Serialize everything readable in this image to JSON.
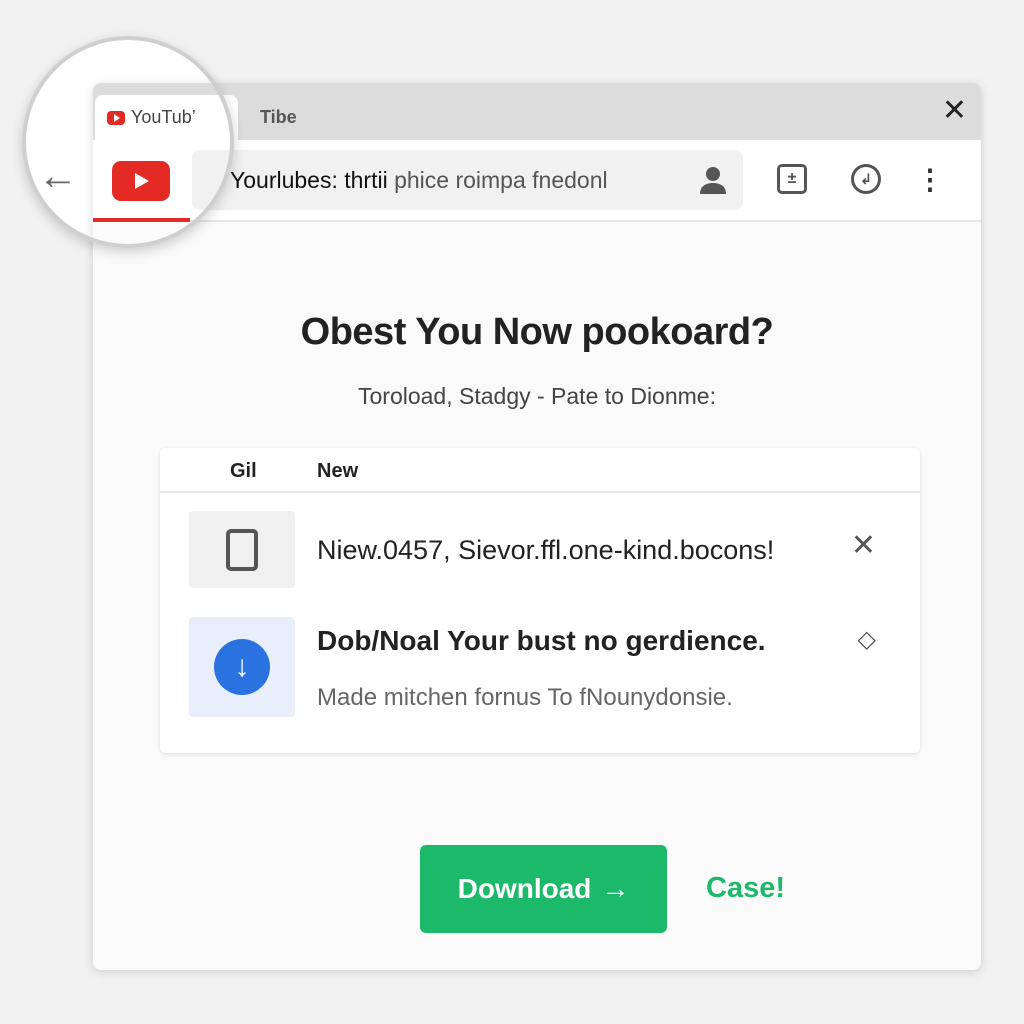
{
  "browser": {
    "tabs": [
      {
        "label": "YouTub’",
        "active": true
      },
      {
        "label": "Tibe",
        "active": false
      }
    ],
    "address_bold": "Yourlubes: thrtii",
    "address_rest": "phice roimpa fnedonl",
    "icons": [
      "back-arrow-icon",
      "youtube-icon",
      "person-icon",
      "extension-icon",
      "history-icon",
      "more-vert-icon",
      "close-icon"
    ]
  },
  "page": {
    "title": "Obest You Now pookoard?",
    "subtitle": "Toroload, Stadgy - Pate to Dionme:",
    "card": {
      "headers": [
        "Gil",
        "New"
      ],
      "rows": [
        {
          "text": "Niew.0457, Sievor.ffl.one-kind.bocons!",
          "icon": "phone-icon",
          "action": "✕"
        },
        {
          "title": "Dob/Noal Your bust no gerdience.",
          "desc": "Made mitchen fornus To fNounydonsie.",
          "icon": "download-icon",
          "action": "◇"
        }
      ]
    },
    "download_label": "Download",
    "download_arrow": "→",
    "cancel_label": "Case!"
  },
  "colors": {
    "accent": "#1db96a",
    "youtube": "#e32a24",
    "download_icon": "#2a72e0"
  }
}
